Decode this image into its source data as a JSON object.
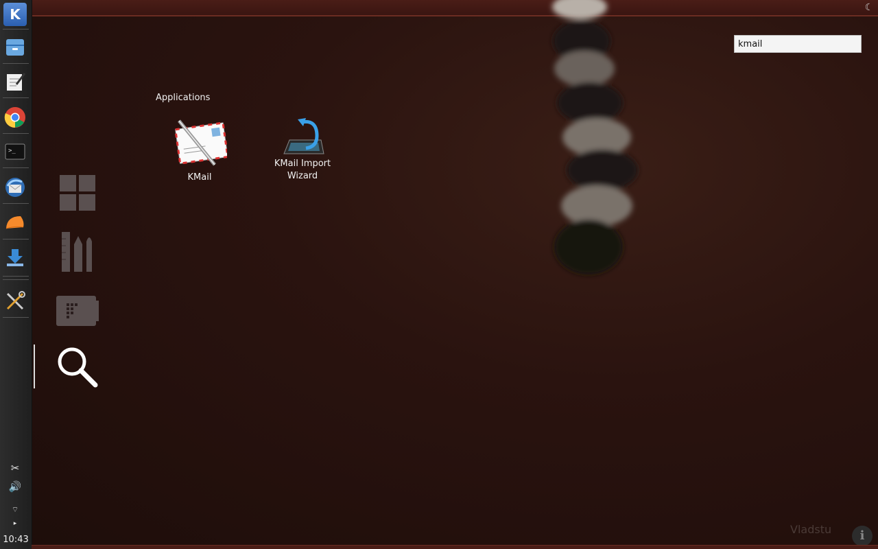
{
  "search": {
    "value": "kmail"
  },
  "results": {
    "section_title": "Applications",
    "items": [
      {
        "label": "KMail"
      },
      {
        "label_line1": "KMail Import",
        "label_line2": "Wizard"
      }
    ]
  },
  "dock": {
    "clock": "10:43",
    "items": [
      {
        "icon": "kde-menu-icon"
      },
      {
        "icon": "file-manager-icon"
      },
      {
        "icon": "text-editor-icon"
      },
      {
        "icon": "chrome-icon"
      },
      {
        "icon": "terminal-icon"
      },
      {
        "icon": "thunderbird-icon"
      },
      {
        "icon": "clementine-icon"
      },
      {
        "icon": "download-icon"
      },
      {
        "icon": "system-settings-icon"
      }
    ]
  },
  "watermark": "Vladstu",
  "colors": {
    "background": "#241110",
    "dock": "#262626",
    "accent_blue": "#3a8bd6"
  }
}
